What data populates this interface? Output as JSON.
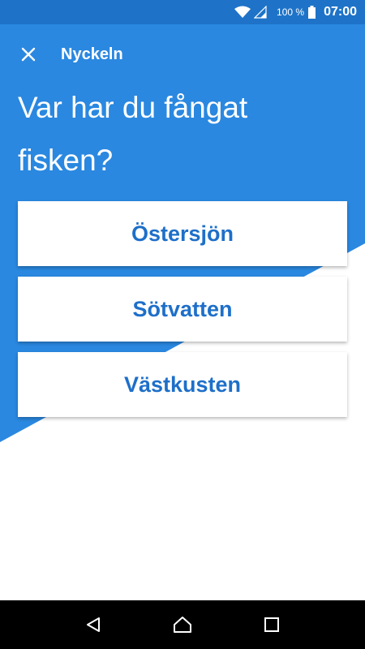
{
  "status_bar": {
    "battery_percent": "100 %",
    "time": "07:00",
    "icons": [
      "wifi-icon",
      "signal-icon",
      "battery-icon"
    ]
  },
  "toolbar": {
    "close_icon": "close-icon",
    "title": "Nyckeln"
  },
  "question": "Var har du fångat fisken?",
  "options": [
    {
      "label": "Östersjön"
    },
    {
      "label": "Sötvatten"
    },
    {
      "label": "Västkusten"
    }
  ],
  "nav_bar": {
    "icons": [
      "back-icon",
      "home-icon",
      "recents-icon"
    ]
  },
  "colors": {
    "primary_blue": "#2a88e0",
    "status_bar_blue": "#1e73c8",
    "option_text": "#1e6fc9",
    "nav_bar": "#000000"
  }
}
